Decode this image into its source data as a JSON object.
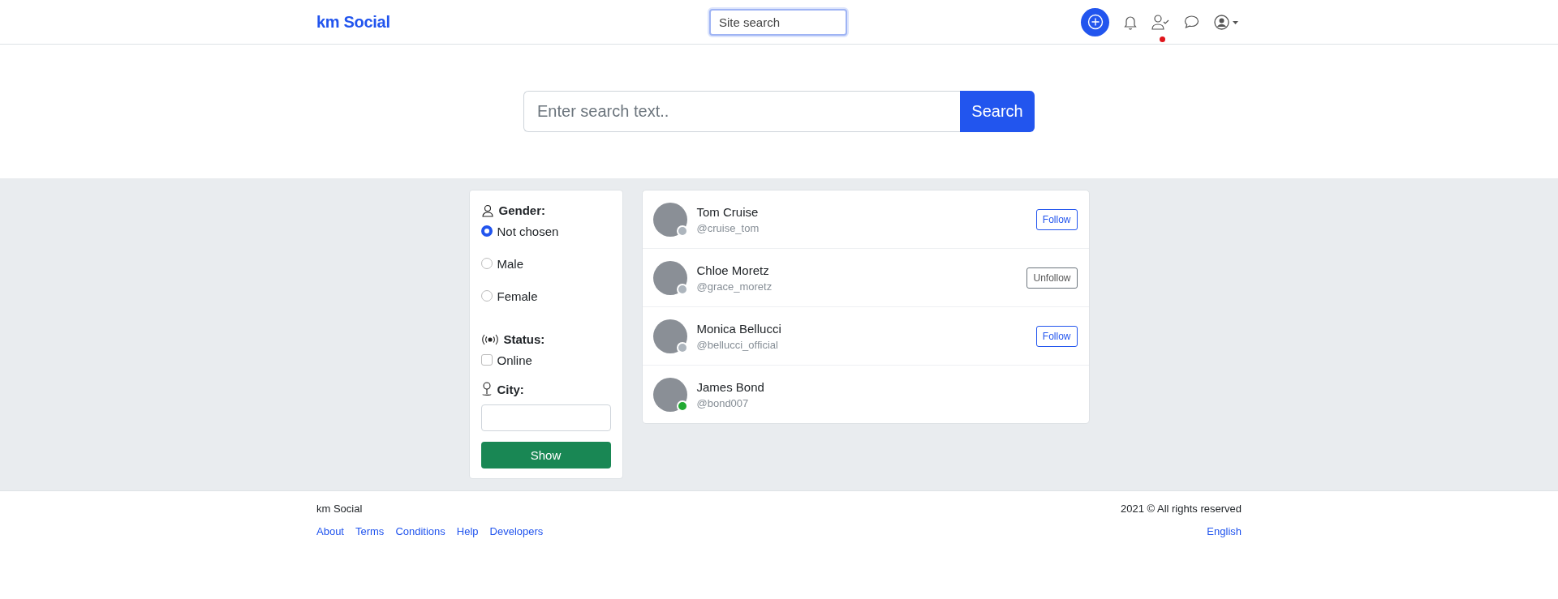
{
  "header": {
    "logo": "km Social",
    "site_search": {
      "placeholder": "Site search"
    },
    "friend_requests_dot": true
  },
  "search": {
    "placeholder": "Enter search text..",
    "button": "Search"
  },
  "filters": {
    "gender": {
      "label": "Gender:",
      "options": [
        {
          "label": "Not chosen",
          "selected": true
        },
        {
          "label": "Male",
          "selected": false
        },
        {
          "label": "Female",
          "selected": false
        }
      ]
    },
    "status": {
      "label": "Status:",
      "options": [
        {
          "label": "Online",
          "checked": false
        }
      ]
    },
    "city": {
      "label": "City:"
    },
    "button": "Show"
  },
  "users": [
    {
      "name": "Tom Cruise",
      "handle": "@cruise_tom",
      "color": "#adb5bd",
      "action": {
        "kind": "follow",
        "label": "Follow"
      }
    },
    {
      "name": "Chloe Moretz",
      "handle": "@grace_moretz",
      "color": "#adb5bd",
      "action": {
        "kind": "unfollow",
        "label": "Unfollow"
      }
    },
    {
      "name": "Monica Bellucci",
      "handle": "@bellucci_official",
      "color": "#adb5bd",
      "action": {
        "kind": "follow",
        "label": "Follow"
      }
    },
    {
      "name": "James Bond",
      "handle": "@bond007",
      "color": "#22aa33"
    }
  ],
  "footer": {
    "brand": "km Social",
    "copyright": "2021 © All rights reserved",
    "links": [
      "About",
      "Terms",
      "Conditions",
      "Help",
      "Developers"
    ],
    "language": "English"
  }
}
